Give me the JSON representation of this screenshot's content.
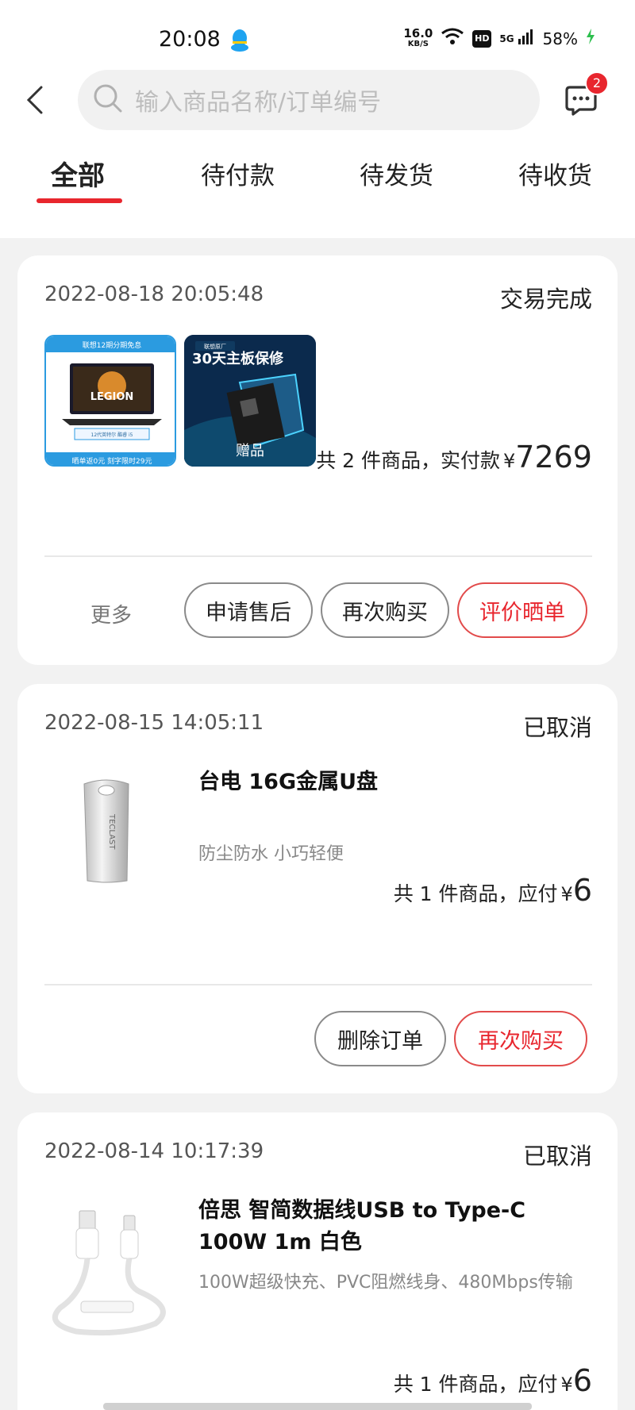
{
  "status_bar": {
    "time": "20:08",
    "net_speed_value": "16.0",
    "net_speed_unit": "KB/S",
    "network": "5G",
    "battery": "58%",
    "icons": [
      "qq-icon",
      "wifi-icon",
      "hd-icon",
      "signal-icon",
      "charging-icon"
    ]
  },
  "header": {
    "search_placeholder": "输入商品名称/订单编号",
    "message_badge": "2"
  },
  "tabs": [
    {
      "label": "全部",
      "active": true
    },
    {
      "label": "待付款",
      "active": false
    },
    {
      "label": "待发货",
      "active": false
    },
    {
      "label": "待收货",
      "active": false
    }
  ],
  "orders": [
    {
      "date": "2022-08-18 20:05:48",
      "status": "交易完成",
      "thumbnails": [
        {
          "banner": "联想12期分期免息",
          "brand": "LEGION",
          "chip": "12代英特尔 酷睿 i5",
          "promo": "晒单返0元 刻字限时29元"
        },
        {
          "tag": "联想原厂",
          "headline": "30天主板保修",
          "caption": "赠品"
        }
      ],
      "summary_prefix": "共 2 件商品，实付款",
      "currency": "¥",
      "amount": "7269",
      "more_label": "更多",
      "actions": [
        "申请售后",
        "再次购买",
        "评价晒单"
      ]
    },
    {
      "date": "2022-08-15 14:05:11",
      "status": "已取消",
      "product_title": "台电 16G金属U盘",
      "product_sub": "防尘防水 小巧轻便",
      "product_brand_mark": "TECLAST",
      "summary_prefix": "共 1 件商品，应付",
      "currency": "¥",
      "amount": "6",
      "actions": [
        "删除订单",
        "再次购买"
      ]
    },
    {
      "date": "2022-08-14 10:17:39",
      "status": "已取消",
      "product_title": "倍思 智简数据线USB to Type-C 100W 1m 白色",
      "product_sub": "100W超级快充、PVC阻燃线身、480Mbps传输",
      "summary_prefix": "共 1 件商品，应付",
      "currency": "¥",
      "amount": "6"
    }
  ],
  "colors": {
    "accent": "#e8262e",
    "page_bg": "#f2f2f2",
    "card_bg": "#ffffff"
  }
}
